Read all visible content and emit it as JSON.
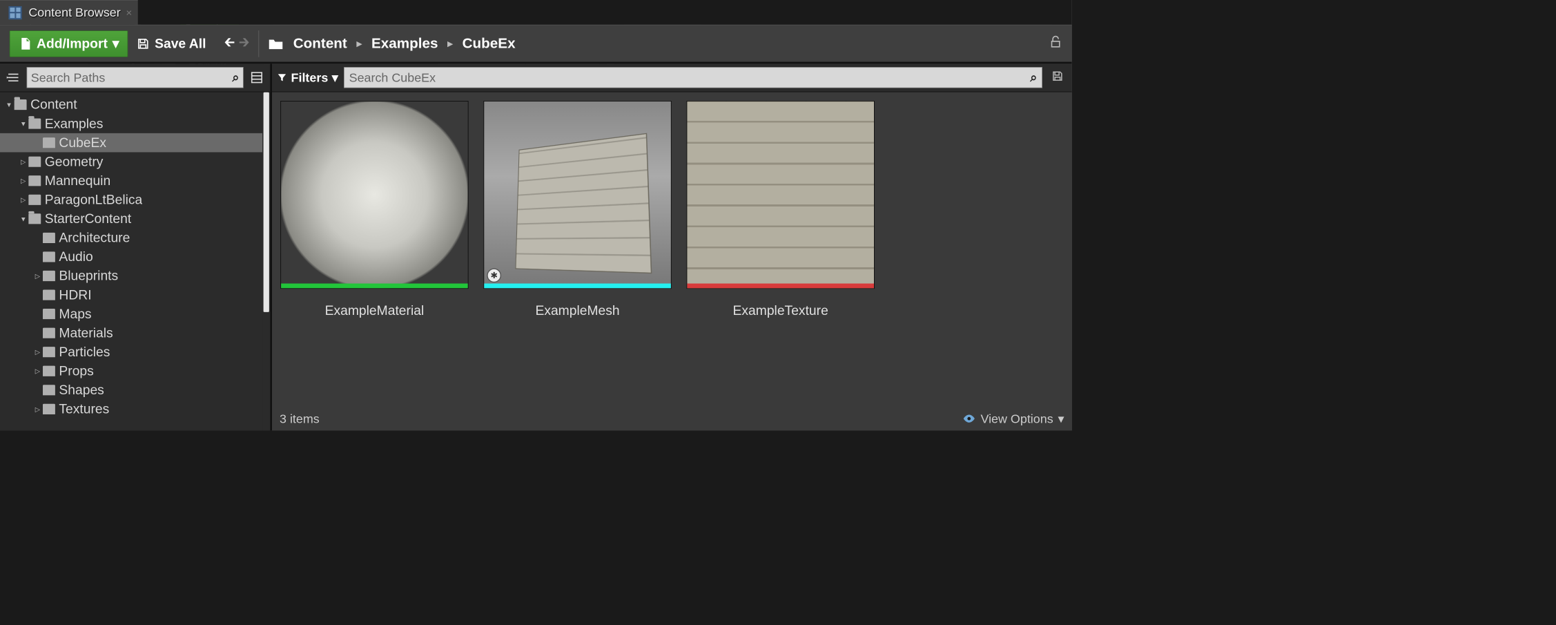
{
  "tab": {
    "title": "Content Browser"
  },
  "toolbar": {
    "add_import": "Add/Import",
    "save_all": "Save All"
  },
  "breadcrumb": [
    "Content",
    "Examples",
    "CubeEx"
  ],
  "sidebar": {
    "search_placeholder": "Search Paths",
    "tree": [
      {
        "label": "Content",
        "depth": 0,
        "expanded": true,
        "caret": "down"
      },
      {
        "label": "Examples",
        "depth": 1,
        "expanded": true,
        "caret": "down"
      },
      {
        "label": "CubeEx",
        "depth": 2,
        "selected": true,
        "caret": "none"
      },
      {
        "label": "Geometry",
        "depth": 1,
        "caret": "right"
      },
      {
        "label": "Mannequin",
        "depth": 1,
        "caret": "right"
      },
      {
        "label": "ParagonLtBelica",
        "depth": 1,
        "caret": "right"
      },
      {
        "label": "StarterContent",
        "depth": 1,
        "expanded": true,
        "caret": "down"
      },
      {
        "label": "Architecture",
        "depth": 2,
        "caret": "none"
      },
      {
        "label": "Audio",
        "depth": 2,
        "caret": "none"
      },
      {
        "label": "Blueprints",
        "depth": 2,
        "caret": "right"
      },
      {
        "label": "HDRI",
        "depth": 2,
        "caret": "none"
      },
      {
        "label": "Maps",
        "depth": 2,
        "caret": "none"
      },
      {
        "label": "Materials",
        "depth": 2,
        "caret": "none"
      },
      {
        "label": "Particles",
        "depth": 2,
        "caret": "right"
      },
      {
        "label": "Props",
        "depth": 2,
        "caret": "right"
      },
      {
        "label": "Shapes",
        "depth": 2,
        "caret": "none"
      },
      {
        "label": "Textures",
        "depth": 2,
        "caret": "right"
      }
    ]
  },
  "main": {
    "filters_label": "Filters",
    "search_placeholder": "Search CubeEx",
    "assets": [
      {
        "name": "ExampleMaterial",
        "stripe": "#22c53a",
        "kind": "material"
      },
      {
        "name": "ExampleMesh",
        "stripe": "#24f0f0",
        "kind": "mesh",
        "badge": true
      },
      {
        "name": "ExampleTexture",
        "stripe": "#d83b3b",
        "kind": "texture"
      }
    ]
  },
  "status": {
    "count_text": "3 items",
    "view_options": "View Options"
  }
}
